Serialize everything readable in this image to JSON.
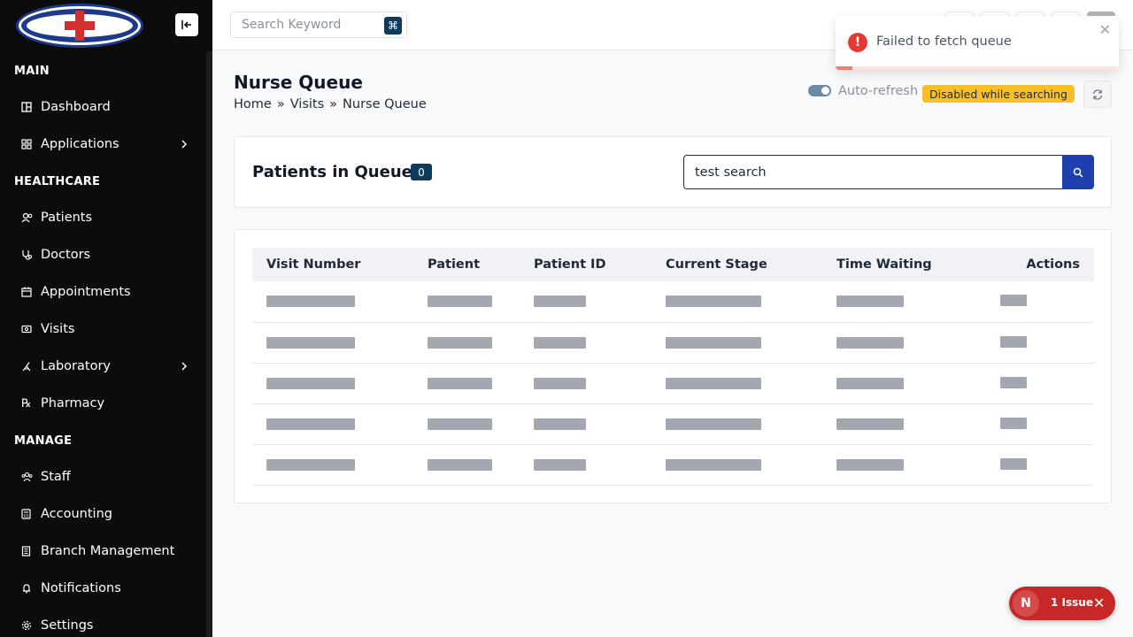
{
  "topbar": {
    "search_placeholder": "Search Keyword",
    "search_shortcut": "⌘"
  },
  "sidebar": {
    "sections": [
      {
        "label": "MAIN"
      },
      {
        "label": "HEALTHCARE"
      },
      {
        "label": "MANAGE"
      }
    ],
    "items": [
      {
        "label": "Dashboard",
        "icon": "dashboard-icon"
      },
      {
        "label": "Applications",
        "icon": "apps-icon",
        "has_submenu": true
      },
      {
        "label": "Patients",
        "icon": "patients-icon"
      },
      {
        "label": "Doctors",
        "icon": "stethoscope-icon"
      },
      {
        "label": "Appointments",
        "icon": "calendar-icon"
      },
      {
        "label": "Visits",
        "icon": "visits-icon"
      },
      {
        "label": "Laboratory",
        "icon": "flask-icon",
        "has_submenu": true
      },
      {
        "label": "Pharmacy",
        "icon": "rx-icon"
      },
      {
        "label": "Staff",
        "icon": "staff-icon"
      },
      {
        "label": "Accounting",
        "icon": "calculator-icon"
      },
      {
        "label": "Branch Management",
        "icon": "building-icon"
      },
      {
        "label": "Notifications",
        "icon": "bell-icon"
      },
      {
        "label": "Settings",
        "icon": "gear-icon"
      }
    ]
  },
  "page": {
    "title": "Nurse Queue",
    "breadcrumb": [
      "Home",
      "Visits",
      "Nurse Queue"
    ],
    "breadcrumb_separator": "»",
    "auto_refresh_label": "Auto-refresh",
    "auto_refresh_badge": "Disabled while searching"
  },
  "queue": {
    "title": "Patients in Queue",
    "count": "0",
    "search_value": "test search"
  },
  "table": {
    "columns": [
      "Visit Number",
      "Patient",
      "Patient ID",
      "Current Stage",
      "Time Waiting",
      "Actions"
    ],
    "skeleton_rows": 5
  },
  "toast": {
    "message": "Failed to fetch queue",
    "type": "error",
    "progress": 0.06
  },
  "issue_pill": {
    "text": "1 Issue"
  },
  "colors": {
    "sidebar_bg": "#0c0c0d",
    "primary": "#0f3b5f",
    "search_button": "#1e40af",
    "warning_badge": "#fbbf24",
    "error": "#e53935"
  }
}
